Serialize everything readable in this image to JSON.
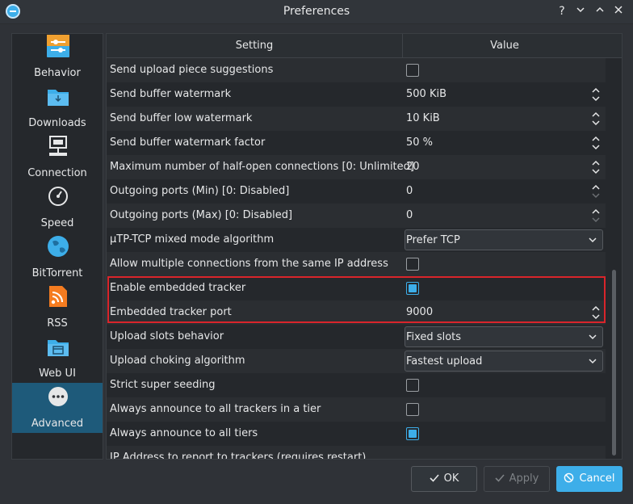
{
  "window": {
    "title": "Preferences",
    "help_glyph": "?",
    "minimize_glyph": "⌄",
    "maximize_glyph": "⌃",
    "close_glyph": "✕"
  },
  "sidebar": {
    "items": [
      {
        "label": "Behavior",
        "icon": "behavior-icon",
        "active": false
      },
      {
        "label": "Downloads",
        "icon": "downloads-folder-icon",
        "active": false
      },
      {
        "label": "Connection",
        "icon": "connection-network-icon",
        "active": false
      },
      {
        "label": "Speed",
        "icon": "speedometer-icon",
        "active": false
      },
      {
        "label": "BitTorrent",
        "icon": "globe-icon",
        "active": false
      },
      {
        "label": "RSS",
        "icon": "rss-icon",
        "active": false
      },
      {
        "label": "Web UI",
        "icon": "webui-folder-icon",
        "active": false
      },
      {
        "label": "Advanced",
        "icon": "more-dots-icon",
        "active": true
      }
    ]
  },
  "table": {
    "headers": {
      "setting": "Setting",
      "value": "Value"
    },
    "rows": [
      {
        "setting": "Send upload piece suggestions",
        "type": "checkbox",
        "checked": false
      },
      {
        "setting": "Send buffer watermark",
        "type": "spin",
        "value": "500 KiB"
      },
      {
        "setting": "Send buffer low watermark",
        "type": "spin",
        "value": "10 KiB"
      },
      {
        "setting": "Send buffer watermark factor",
        "type": "spin",
        "value": "50 %"
      },
      {
        "setting": "Maximum number of half-open connections [0: Unlimited]",
        "type": "spin",
        "value": "20"
      },
      {
        "setting": "Outgoing ports (Min) [0: Disabled]",
        "type": "spin",
        "value": "0"
      },
      {
        "setting": "Outgoing ports (Max) [0: Disabled]",
        "type": "spin",
        "value": "0"
      },
      {
        "setting": "µTP-TCP mixed mode algorithm",
        "type": "combo",
        "value": "Prefer TCP"
      },
      {
        "setting": "Allow multiple connections from the same IP address",
        "type": "checkbox",
        "checked": false
      },
      {
        "setting": "Enable embedded tracker",
        "type": "checkbox",
        "checked": true
      },
      {
        "setting": "Embedded tracker port",
        "type": "spin",
        "value": "9000"
      },
      {
        "setting": "Upload slots behavior",
        "type": "combo",
        "value": "Fixed slots"
      },
      {
        "setting": "Upload choking algorithm",
        "type": "combo",
        "value": "Fastest upload"
      },
      {
        "setting": "Strict super seeding",
        "type": "checkbox",
        "checked": false
      },
      {
        "setting": "Always announce to all trackers in a tier",
        "type": "checkbox",
        "checked": false
      },
      {
        "setting": "Always announce to all tiers",
        "type": "checkbox",
        "checked": true
      },
      {
        "setting": "IP Address to report to trackers (requires restart)",
        "type": "text",
        "value": ""
      }
    ]
  },
  "buttons": {
    "ok": "OK",
    "apply": "Apply",
    "cancel": "Cancel"
  },
  "colors": {
    "accent": "#3daee9",
    "highlight_border": "#d9252b"
  }
}
